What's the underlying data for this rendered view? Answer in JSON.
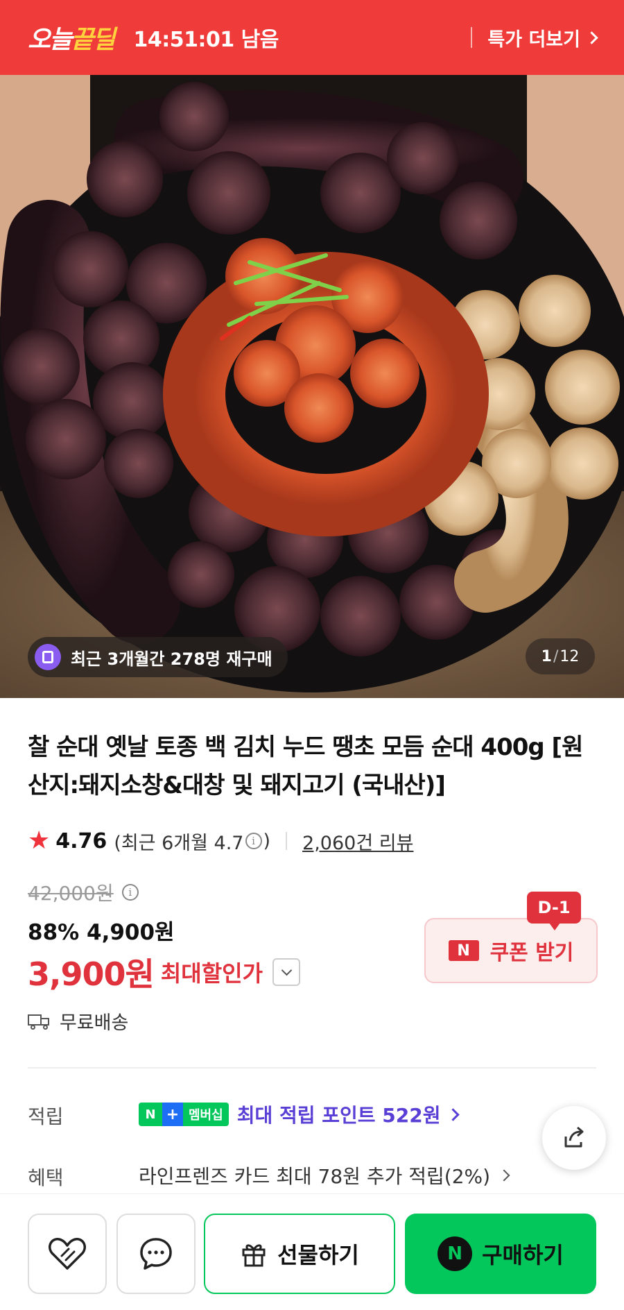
{
  "deal_bar": {
    "brand_prefix": "오늘",
    "brand_highlight": "끝딜",
    "time_left": "14:51:01 남음",
    "more_deals": "특가 더보기"
  },
  "gallery": {
    "repurchase_badge": "최근 3개월간 278명 재구매",
    "current": "1",
    "separator": "/",
    "total": "12"
  },
  "product": {
    "title": "찰 순대 옛날 토종 백 김치 누드 땡초 모듬 순대 400g [원산지:돼지소창&대창 및 돼지고기 (국내산)]",
    "rating": "4.76",
    "recent_rating_prefix": "(최근 6개월 4.7",
    "recent_rating_suffix": ")",
    "reviews": "2,060건 리뷰",
    "original_price": "42,000원",
    "discount_rate": "88%",
    "sale_price": "4,900원",
    "final_price": "3,900원",
    "final_price_label": "최대할인가",
    "shipping": "무료배송"
  },
  "coupon": {
    "dday": "D-1",
    "logo": "N",
    "label": "쿠폰 받기"
  },
  "points": {
    "label": "적립",
    "badge_n": "N",
    "badge_plus": "+",
    "badge_membership": "멤버십",
    "text": "최대 적립 포인트 522원"
  },
  "benefit": {
    "label": "혜택",
    "text": "라인프렌즈 카드 최대 78원 추가 적립(2%)"
  },
  "bottom": {
    "gift_label": "선물하기",
    "buy_logo": "N",
    "buy_label": "구매하기"
  },
  "colors": {
    "deal_red": "#f03b3b",
    "price_red": "#e0323c",
    "naver_green": "#03c75a",
    "membership_purple": "#5a3fd6"
  },
  "icons": [
    "chevron-right-icon",
    "bag-icon",
    "star-icon",
    "info-icon",
    "truck-icon",
    "chevron-down-icon",
    "share-icon",
    "heart-icon",
    "chat-icon",
    "gift-icon"
  ]
}
